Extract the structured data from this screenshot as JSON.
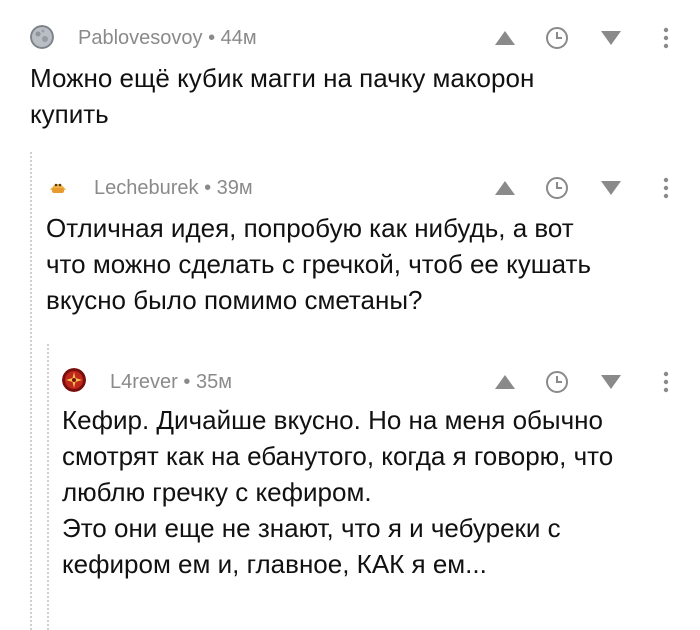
{
  "comments": [
    {
      "username": "Pablovesovoy",
      "separator": "•",
      "time": "44м",
      "avatar": "moon-avatar",
      "text": "Можно ещё кубик магги на пачку макорон\nкупить"
    },
    {
      "username": "Lecheburek",
      "separator": "•",
      "time": "39м",
      "avatar": "cartoon-avatar",
      "text": "Отличная идея, попробую как нибудь, а вот\nчто можно сделать с гречкой, чтоб ее кушать\nвкусно было помимо сметаны?"
    },
    {
      "username": "L4rever",
      "separator": "•",
      "time": "35м",
      "avatar": "red-emblem-avatar",
      "text": "Кефир. Дичайше вкусно. Но на меня обычно\nсмотрят как на ебанутого, когда я говорю, что\nлюблю гречку с кефиром.\nЭто они еще не знают, что я и чебуреки с\nкефиром ем и, главное, КАК я ем..."
    }
  ],
  "icons": {
    "upvote": "arrow-up-icon",
    "save": "clock-icon",
    "downvote": "arrow-down-icon",
    "more": "more-vertical-icon"
  },
  "colors": {
    "meta": "#8a8a8a",
    "icon": "#8a8a8a",
    "text": "#111111",
    "thread_line": "#cfcfcf"
  }
}
